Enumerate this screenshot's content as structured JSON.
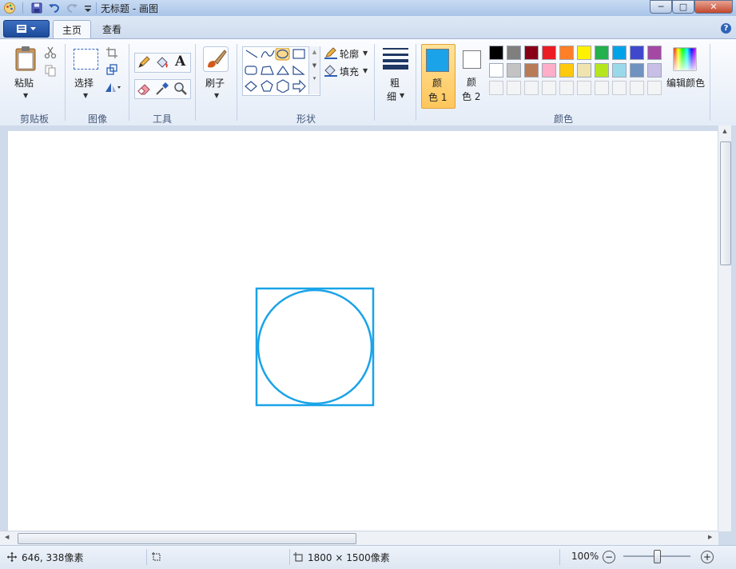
{
  "window": {
    "title": "无标题 - 画图",
    "icons": [
      "paint-app-icon",
      "save-icon",
      "undo-icon",
      "redo-icon",
      "customize-dropdown-icon"
    ],
    "controls": {
      "minimize": "─",
      "maximize": "□",
      "close": "✕"
    }
  },
  "tabs": {
    "home": "主页",
    "view": "查看"
  },
  "help": "?",
  "ribbon": {
    "clipboard": {
      "paste": "粘贴",
      "group": "剪贴板"
    },
    "image": {
      "select": "选择",
      "group": "图像"
    },
    "tools": {
      "text_glyph": "A",
      "group": "工具"
    },
    "brushes": {
      "label": "刷子"
    },
    "shapes": {
      "outline": "轮廓",
      "fill": "填充",
      "group": "形状"
    },
    "size": {
      "line1": "粗",
      "line2": "细"
    },
    "colors": {
      "color1_line1": "颜",
      "color1_line2": "色 1",
      "color2_line1": "颜",
      "color2_line2": "色 2",
      "edit": "编辑颜色",
      "group": "颜色",
      "color1_value": "#1aa3e8",
      "color2_value": "#ffffff",
      "palette_row1": [
        "#000000",
        "#7f7f7f",
        "#880015",
        "#ed1c24",
        "#ff7f27",
        "#fff200",
        "#22b14c",
        "#00a2e8",
        "#3f48cc",
        "#a349a4"
      ],
      "palette_row2": [
        "#ffffff",
        "#c3c3c3",
        "#b97a57",
        "#ffaec9",
        "#ffc90e",
        "#efe4b0",
        "#b5e61d",
        "#99d9ea",
        "#7092be",
        "#c8bfe7"
      ]
    }
  },
  "canvas": {
    "shape_color": "#1aa3e8"
  },
  "status": {
    "cursor": "646, 338像素",
    "size": "1800 × 1500像素",
    "zoom": "100%",
    "zoom_minus": "−",
    "zoom_plus": "+"
  }
}
